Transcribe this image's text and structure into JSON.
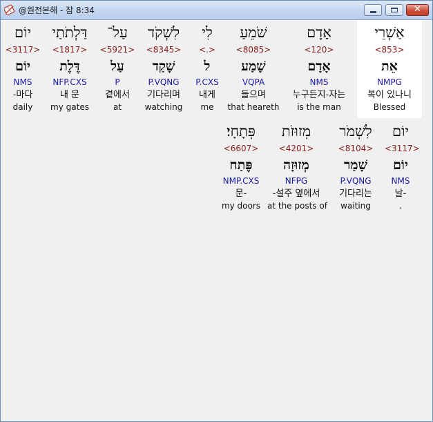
{
  "window": {
    "title": "@원전본해 - 잠 8:34",
    "minimize_icon": "minimize-icon",
    "maximize_icon": "maximize-icon",
    "close_icon": "close-icon",
    "close_glyph": "✕"
  },
  "row1": [
    {
      "hebrew": "יוֹם",
      "strong": "<3117>",
      "lemma": "יוֹם",
      "morph": "NMS",
      "korean": "-마다",
      "english": "daily"
    },
    {
      "hebrew": "דַּלְתֹתַי",
      "strong": "<1817>",
      "lemma": "דֶּלֶת",
      "morph": "NFP.CXS",
      "korean": "내 문",
      "english": "my gates"
    },
    {
      "hebrew": "עַל־",
      "strong": "<5921>",
      "lemma": "עַל",
      "morph": "P",
      "korean": "곁에서",
      "english": "at"
    },
    {
      "hebrew": "לִשְׁקֹד",
      "strong": "<8345>",
      "lemma": "שָׁקַד",
      "morph": "P.VQNG",
      "korean": "기다리며",
      "english": "watching"
    },
    {
      "hebrew": "לִי",
      "strong": "<.>",
      "lemma": "ל",
      "morph": "P.CXS",
      "korean": "내게",
      "english": "me"
    },
    {
      "hebrew": "שֹׁמֵעַ",
      "strong": "<8085>",
      "lemma": "שָׁמַע",
      "morph": "VQPA",
      "korean": "들으며",
      "english": "that heareth"
    },
    {
      "hebrew": "אָדָם",
      "strong": "<120>",
      "lemma": "אָדָם",
      "morph": "NMS",
      "korean": "누구든지-자는",
      "english": "is the man"
    },
    {
      "hebrew": "אַשְׁרֵי",
      "strong": "<853>",
      "lemma": "אֵת",
      "morph": "NMPG",
      "korean": "복이 있나니",
      "english": "Blessed"
    }
  ],
  "row2": [
    {
      "hebrew": "פְּתָחָי׃",
      "strong": "<6607>",
      "lemma": "פֶּתַח",
      "morph": "NMP.CXS",
      "korean": "문-",
      "english": "my doors"
    },
    {
      "hebrew": "מְזוּזֹת",
      "strong": "<4201>",
      "lemma": "מְזוּזָה",
      "morph": "NFPG",
      "korean": "-설주 옆에서",
      "english": "at the posts of"
    },
    {
      "hebrew": "לִשְׁמֹר",
      "strong": "<8104>",
      "lemma": "שָׁמַר",
      "morph": "P.VQNG",
      "korean": "기다리는",
      "english": "waiting"
    },
    {
      "hebrew": "יוֹם",
      "strong": "<3117>",
      "lemma": "יוֹם",
      "morph": "NMS",
      "korean": "날-",
      "english": "."
    }
  ]
}
